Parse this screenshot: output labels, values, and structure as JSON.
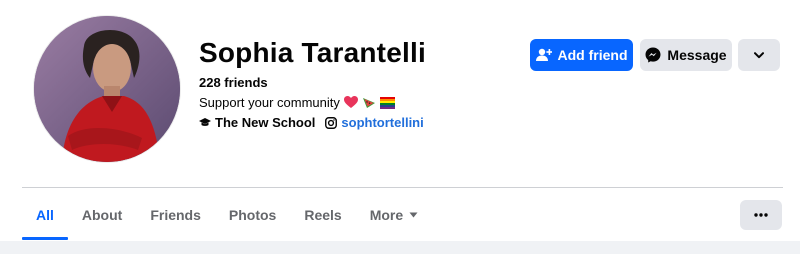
{
  "profile": {
    "name": "Sophia Tarantelli",
    "friends": "228 friends",
    "bio": "Support your community",
    "school": "The New School",
    "instagram": "sophtortellini"
  },
  "actions": {
    "add_friend": "Add friend",
    "message": "Message"
  },
  "tabs": [
    {
      "label": "All",
      "active": true
    },
    {
      "label": "About",
      "active": false
    },
    {
      "label": "Friends",
      "active": false
    },
    {
      "label": "Photos",
      "active": false
    },
    {
      "label": "Reels",
      "active": false
    },
    {
      "label": "More",
      "active": false
    }
  ],
  "icons": {
    "bio_emojis": [
      "heart-icon",
      "watermelon-icon",
      "rainbow-flag-icon"
    ],
    "school": "graduation-cap-icon",
    "instagram": "instagram-icon",
    "add_friend": "add-person-icon",
    "message": "messenger-icon",
    "more": "chevron-down-icon",
    "tabs_more": "ellipsis-icon"
  },
  "colors": {
    "primary": "#0866ff",
    "link": "#216fdb",
    "secondary_button": "#e4e6eb",
    "muted_text": "#65676b"
  }
}
